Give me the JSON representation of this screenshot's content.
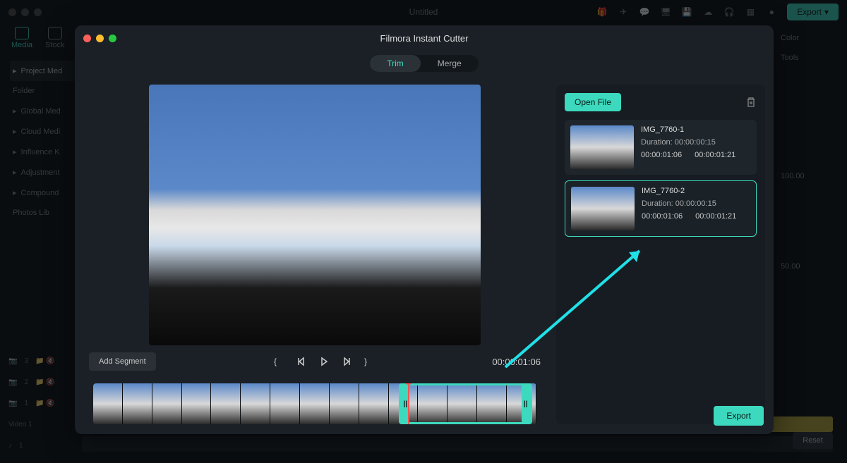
{
  "main": {
    "title": "Untitled",
    "export_label": "Export"
  },
  "tabs": {
    "media": "Media",
    "stock": "Stock"
  },
  "sidebar": {
    "project": "Project Med",
    "folder": "Folder",
    "global": "Global Med",
    "cloud": "Cloud Medi",
    "influence": "Influence K",
    "adjustment": "Adjustment",
    "compound": "Compound",
    "photos": "Photos Lib"
  },
  "right": {
    "color": "Color",
    "tools": "Tools",
    "value": "100.00",
    "value2": "50.00",
    "reset": "Reset"
  },
  "tracks": {
    "t3": "3",
    "t2": "2",
    "t1": "1",
    "video1": "Video 1",
    "a1": "1"
  },
  "modal": {
    "title": "Filmora Instant Cutter",
    "trim": "Trim",
    "merge": "Merge",
    "add_segment": "Add Segment",
    "timecode": "00:00:01:06",
    "open_file": "Open File",
    "export": "Export"
  },
  "clips": [
    {
      "name": "IMG_7760-1",
      "duration_label": "Duration:",
      "duration": "00:00:00:15",
      "start": "00:00:01:06",
      "end": "00:00:01:21"
    },
    {
      "name": "IMG_7760-2",
      "duration_label": "Duration:",
      "duration": "00:00:00:15",
      "start": "00:00:01:06",
      "end": "00:00:01:21"
    }
  ]
}
